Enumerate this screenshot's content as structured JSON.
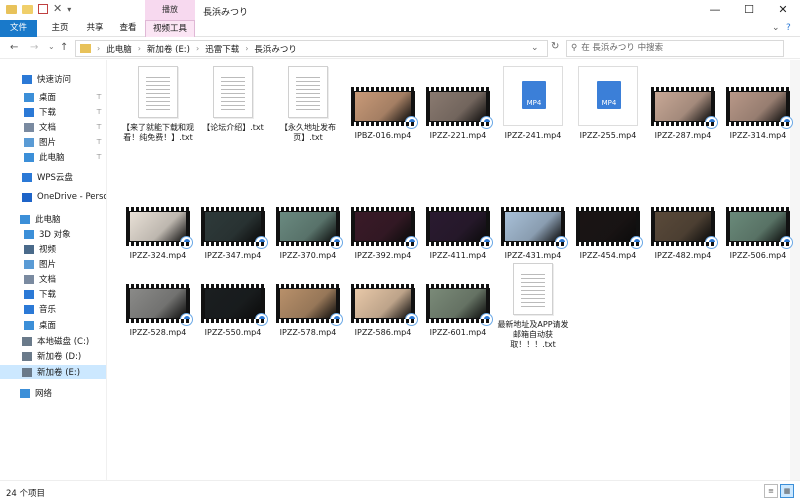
{
  "window": {
    "title": "長浜みつり",
    "context_group": "播放",
    "controls": {
      "minimize": "—",
      "maximize": "☐",
      "close": "✕"
    }
  },
  "ribbon": {
    "tabs": [
      "文件",
      "主页",
      "共享",
      "查看",
      "视频工具"
    ],
    "expand_icon": "⌄",
    "help_icon": "?"
  },
  "address": {
    "back": "←",
    "forward": "→",
    "recent": "⌄",
    "up": "↑",
    "breadcrumb": [
      "此电脑",
      "新加卷 (E:)",
      "迅雷下载",
      "長浜みつり"
    ],
    "dropdown": "⌄",
    "refresh": "↻",
    "search_placeholder": "在 長浜みつり 中搜索"
  },
  "sidebar": {
    "items": [
      {
        "label": "快速访问",
        "icon": "star-icon",
        "color": "#2b79d6"
      },
      {
        "label": "桌面",
        "icon": "desktop-icon",
        "color": "#3c8fd8",
        "pinned": true
      },
      {
        "label": "下载",
        "icon": "download-icon",
        "color": "#2b79d6",
        "pinned": true
      },
      {
        "label": "文档",
        "icon": "document-icon",
        "color": "#7a8aa0",
        "pinned": true
      },
      {
        "label": "图片",
        "icon": "pictures-icon",
        "color": "#5a9bd5",
        "pinned": true
      },
      {
        "label": "此电脑",
        "icon": "computer-icon",
        "color": "#3c8fd8",
        "pinned": true
      },
      {
        "label": "WPS云盘",
        "icon": "cloud-icon",
        "color": "#2b79d6"
      },
      {
        "label": "OneDrive - Persona",
        "icon": "onedrive-icon",
        "color": "#1e64c8"
      },
      {
        "label": "此电脑",
        "icon": "computer-icon",
        "color": "#3c8fd8"
      },
      {
        "label": "3D 对象",
        "icon": "cube-icon",
        "color": "#3c8fd8"
      },
      {
        "label": "视频",
        "icon": "video-icon",
        "color": "#4a6a8a"
      },
      {
        "label": "图片",
        "icon": "pictures-icon",
        "color": "#5a9bd5"
      },
      {
        "label": "文档",
        "icon": "document-icon",
        "color": "#7a8aa0"
      },
      {
        "label": "下载",
        "icon": "download-icon",
        "color": "#2b79d6"
      },
      {
        "label": "音乐",
        "icon": "music-icon",
        "color": "#2b79d6"
      },
      {
        "label": "桌面",
        "icon": "desktop-icon",
        "color": "#3c8fd8"
      },
      {
        "label": "本地磁盘 (C:)",
        "icon": "drive-icon",
        "color": "#6a7a8a"
      },
      {
        "label": "新加卷 (D:)",
        "icon": "drive-icon",
        "color": "#6a7a8a"
      },
      {
        "label": "新加卷 (E:)",
        "icon": "drive-icon",
        "color": "#6a7a8a",
        "selected": true
      },
      {
        "label": "网络",
        "icon": "network-icon",
        "color": "#3c8fd8"
      }
    ],
    "pin_glyph": "📌"
  },
  "files": [
    {
      "name": "【来了就能下载和观看！纯免费！】.txt",
      "kind": "txt"
    },
    {
      "name": "【论坛介绍】.txt",
      "kind": "txt"
    },
    {
      "name": "【永久地址发布页】.txt",
      "kind": "txt"
    },
    {
      "name": "IPBZ-016.mp4",
      "kind": "vid",
      "tone": "#c99a78"
    },
    {
      "name": "IPZZ-221.mp4",
      "kind": "vid",
      "tone": "#8a7a70"
    },
    {
      "name": "IPZZ-241.mp4",
      "kind": "mp4"
    },
    {
      "name": "IPZZ-255.mp4",
      "kind": "mp4"
    },
    {
      "name": "IPZZ-287.mp4",
      "kind": "vid",
      "tone": "#c8a896"
    },
    {
      "name": "IPZZ-314.mp4",
      "kind": "vid",
      "tone": "#b89888"
    },
    {
      "name": "IPZZ-324.mp4",
      "kind": "vid",
      "tone": "#e8e0d6"
    },
    {
      "name": "IPZZ-347.mp4",
      "kind": "vid",
      "tone": "#2e3a3a"
    },
    {
      "name": "IPZZ-370.mp4",
      "kind": "vid",
      "tone": "#6a8a80"
    },
    {
      "name": "IPZZ-392.mp4",
      "kind": "vid",
      "tone": "#3a1a28"
    },
    {
      "name": "IPZZ-411.mp4",
      "kind": "vid",
      "tone": "#2a1a30"
    },
    {
      "name": "IPZZ-431.mp4",
      "kind": "vid",
      "tone": "#a8c0d8"
    },
    {
      "name": "IPZZ-454.mp4",
      "kind": "vid",
      "tone": "#1a1414"
    },
    {
      "name": "IPZZ-482.mp4",
      "kind": "vid",
      "tone": "#5a4a3a"
    },
    {
      "name": "IPZZ-506.mp4",
      "kind": "vid",
      "tone": "#6a8a7a"
    },
    {
      "name": "IPZZ-528.mp4",
      "kind": "vid",
      "tone": "#8a8a88"
    },
    {
      "name": "IPZZ-550.mp4",
      "kind": "vid",
      "tone": "#1a1e20"
    },
    {
      "name": "IPZZ-578.mp4",
      "kind": "vid",
      "tone": "#b8906a"
    },
    {
      "name": "IPZZ-586.mp4",
      "kind": "vid",
      "tone": "#e8c8a8"
    },
    {
      "name": "IPZZ-601.mp4",
      "kind": "vid",
      "tone": "#7a8a78"
    },
    {
      "name": "最新地址及APP请发邮箱自动获取！！！.txt",
      "kind": "txt"
    }
  ],
  "status": {
    "count": "24 个项目",
    "view_details": "≡",
    "view_icons": "▦"
  }
}
